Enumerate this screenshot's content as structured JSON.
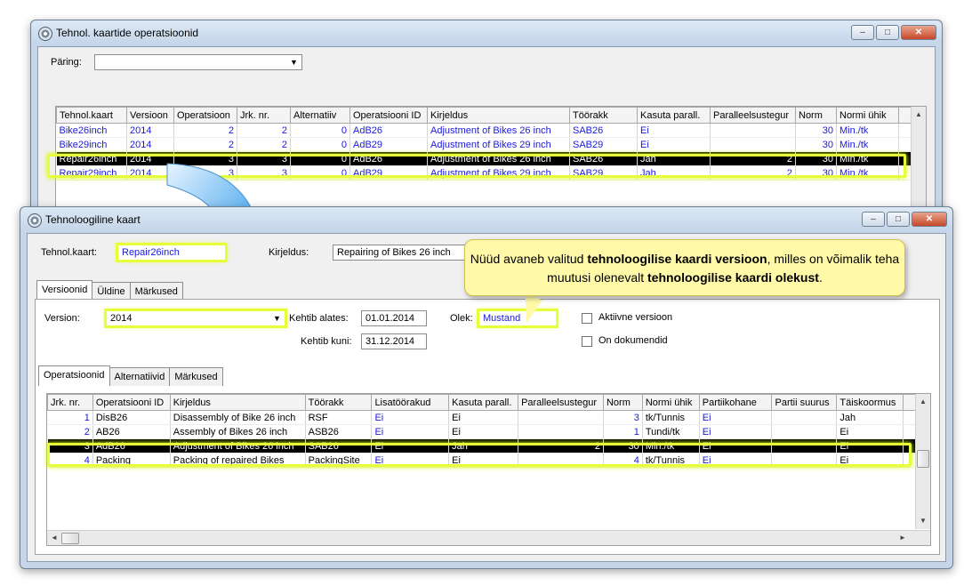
{
  "back_window": {
    "title": "Tehnol. kaartide operatsioonid",
    "query_label": "Päring:",
    "query_value": "",
    "columns": [
      "Tehnol.kaart",
      "Versioon",
      "Operatsioon",
      "Jrk. nr.",
      "Alternatiiv",
      "Operatsiooni ID",
      "Kirjeldus",
      "Töörakk",
      "Kasuta parall.",
      "Paralleelsustegur",
      "Norm",
      "Normi ühik"
    ],
    "rows": [
      [
        "Bike26inch",
        "2014",
        "2",
        "2",
        "0",
        "AdB26",
        "Adjustment of Bikes 26 inch",
        "SAB26",
        "Ei",
        "",
        "30",
        "Min./tk"
      ],
      [
        "Bike29inch",
        "2014",
        "2",
        "2",
        "0",
        "AdB29",
        "Adjustment of Bikes 29 inch",
        "SAB29",
        "Ei",
        "",
        "30",
        "Min./tk"
      ],
      [
        "Repair26inch",
        "2014",
        "3",
        "3",
        "0",
        "AdB26",
        "Adjustment of Bikes 26 inch",
        "SAB26",
        "Jah",
        "2",
        "30",
        "Min./tk"
      ],
      [
        "Repair29inch",
        "2014",
        "3",
        "3",
        "0",
        "AdB29",
        "Adjustment of Bikes 29 inch",
        "SAB29",
        "Jah",
        "2",
        "30",
        "Min./tk"
      ]
    ],
    "selected_row": 2
  },
  "front_window": {
    "title": "Tehnoloogiline kaart",
    "card_label": "Tehnol.kaart:",
    "card_value": "Repair26inch",
    "description_label": "Kirjeldus:",
    "description_value": "Repairing of Bikes 26 inch",
    "tabs": [
      "Versioonid",
      "Üldine",
      "Märkused"
    ],
    "version_label": "Version:",
    "version_value": "2014",
    "valid_from_label": "Kehtib alates:",
    "valid_from_value": "01.01.2014",
    "valid_to_label": "Kehtib kuni:",
    "valid_to_value": "31.12.2014",
    "status_label": "Olek:",
    "status_value": "Mustand",
    "active_version_label": "Aktiivne versioon",
    "has_documents_label": "On dokumendid",
    "sub_tabs": [
      "Operatsioonid",
      "Alternatiivid",
      "Märkused"
    ],
    "columns": [
      "Jrk. nr.",
      "Operatsiooni ID",
      "Kirjeldus",
      "Töörakk",
      "Lisatöörakud",
      "Kasuta parall.",
      "Paralleelsustegur",
      "Norm",
      "Normi ühik",
      "Partiikohane",
      "Partii suurus",
      "Täiskoormus"
    ],
    "rows": [
      [
        "1",
        "DisB26",
        "Disassembly of Bike 26 inch",
        "RSF",
        "Ei",
        "Ei",
        "",
        "3",
        "tk/Tunnis",
        "Ei",
        "",
        "Jah"
      ],
      [
        "2",
        "AB26",
        "Assembly of Bikes 26 inch",
        "ASB26",
        "Ei",
        "Ei",
        "",
        "1",
        "Tundi/tk",
        "Ei",
        "",
        "Ei"
      ],
      [
        "3",
        "AdB26",
        "Adjustment of Bikes 26 inch",
        "SAB26",
        "Ei",
        "Jah",
        "2",
        "30",
        "Min./tk",
        "Ei",
        "",
        "Ei"
      ],
      [
        "4",
        "Packing",
        "Packing of repaired Bikes",
        "PackingSite",
        "Ei",
        "Ei",
        "",
        "4",
        "tk/Tunnis",
        "Ei",
        "",
        "Ei"
      ]
    ],
    "selected_row": 2
  },
  "callout": {
    "part1": "Nüüd avaneb valitud ",
    "bold1": "tehnoloogilise kaardi versioon",
    "part2": ", milles on võimalik teha muutusi olenevalt ",
    "bold2": "tehnoloogilise kaardi olekust",
    "part3": "."
  },
  "window_buttons": {
    "minimize": "–",
    "maximize": "□",
    "close": "✕"
  }
}
